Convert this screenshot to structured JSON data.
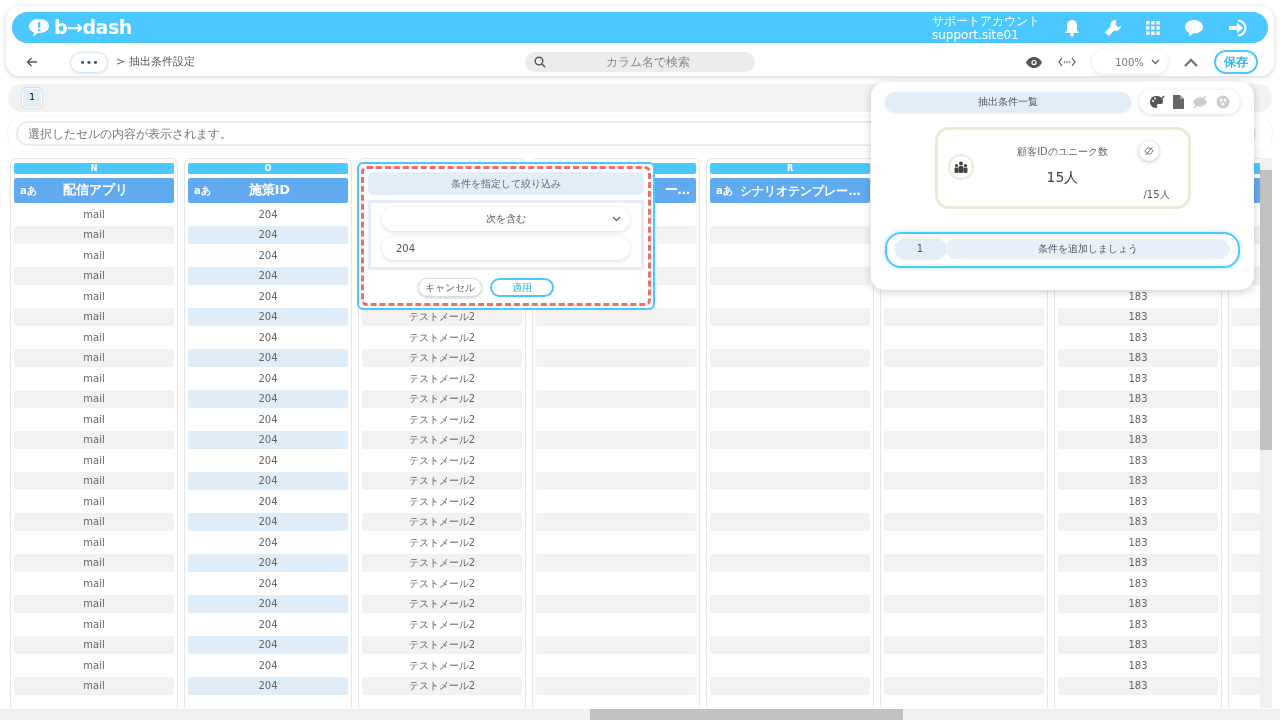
{
  "header": {
    "logo": "b→dash",
    "account_name": "サポートアカウント",
    "account_id": "support.site01"
  },
  "toolbar": {
    "more": "•••",
    "breadcrumb": "> 抽出条件設定",
    "search": {
      "placeholder": "カラム名で検索"
    },
    "zoom": "100%",
    "save": "保存"
  },
  "sheet_tabs": [
    {
      "label": "1",
      "selected": true
    }
  ],
  "cell_preview": {
    "placeholder": "選択したセルの内容が表示されます。"
  },
  "table": {
    "columns": [
      {
        "letter": "N",
        "type_badge": "aあ",
        "label": "配信アプリ",
        "filtered": false
      },
      {
        "letter": "O",
        "type_badge": "aあ",
        "label": "施策ID",
        "filtered": true
      },
      {
        "filtered": false
      },
      {
        "label": "ー…",
        "filtered": false
      },
      {
        "letter": "R",
        "type_badge": "aあ",
        "label": "シナリオテンプレー…",
        "filtered": false
      },
      {
        "filtered": false
      },
      {
        "filtered": false
      },
      {
        "filtered": false
      }
    ],
    "rows": [
      {
        "column_1": "mail",
        "column_2": "204"
      },
      {
        "column_1": "mail",
        "column_2": "204"
      },
      {
        "column_1": "mail",
        "column_2": "204"
      },
      {
        "column_1": "mail",
        "column_2": "204"
      },
      {
        "column_1": "mail",
        "column_2": "204",
        "column_7": "183"
      },
      {
        "column_1": "mail",
        "column_2": "204",
        "column_3": "テストメール2",
        "column_7": "183"
      },
      {
        "column_1": "mail",
        "column_2": "204",
        "column_3": "テストメール2",
        "column_7": "183"
      },
      {
        "column_1": "mail",
        "column_2": "204",
        "column_3": "テストメール2",
        "column_7": "183"
      },
      {
        "column_1": "mail",
        "column_2": "204",
        "column_3": "テストメール2",
        "column_7": "183"
      },
      {
        "column_1": "mail",
        "column_2": "204",
        "column_3": "テストメール2",
        "column_7": "183"
      },
      {
        "column_1": "mail",
        "column_2": "204",
        "column_3": "テストメール2",
        "column_7": "183"
      },
      {
        "column_1": "mail",
        "column_2": "204",
        "column_3": "テストメール2",
        "column_7": "183"
      },
      {
        "column_1": "mail",
        "column_2": "204",
        "column_3": "テストメール2",
        "column_7": "183"
      },
      {
        "column_1": "mail",
        "column_2": "204",
        "column_3": "テストメール2",
        "column_7": "183"
      },
      {
        "column_1": "mail",
        "column_2": "204",
        "column_3": "テストメール2",
        "column_7": "183"
      },
      {
        "column_1": "mail",
        "column_2": "204",
        "column_3": "テストメール2",
        "column_7": "183"
      },
      {
        "column_1": "mail",
        "column_2": "204",
        "column_3": "テストメール2",
        "column_7": "183"
      },
      {
        "column_1": "mail",
        "column_2": "204",
        "column_3": "テストメール2",
        "column_7": "183"
      },
      {
        "column_1": "mail",
        "column_2": "204",
        "column_3": "テストメール2",
        "column_7": "183"
      },
      {
        "column_1": "mail",
        "column_2": "204",
        "column_3": "テストメール2",
        "column_7": "183"
      },
      {
        "column_1": "mail",
        "column_2": "204",
        "column_3": "テストメール2",
        "column_7": "183"
      },
      {
        "column_1": "mail",
        "column_2": "204",
        "column_3": "テストメール2",
        "column_7": "183"
      },
      {
        "column_1": "mail",
        "column_2": "204",
        "column_3": "テストメール2",
        "column_7": "183"
      },
      {
        "column_1": "mail",
        "column_2": "204",
        "column_3": "テストメール2",
        "column_7": "183"
      }
    ]
  },
  "filter_popup": {
    "title": "条件を指定して絞り込み",
    "operator": "次を含む",
    "value": "204",
    "cancel": "キャンセル",
    "apply": "適用"
  },
  "condition_panel": {
    "tab": "抽出条件一覧",
    "metric": {
      "title": "顧客IDのユニーク数",
      "value": "15人",
      "total": "/15人"
    },
    "conditions": [
      {
        "number": "1",
        "label": "条件を追加しましょう"
      }
    ]
  }
}
